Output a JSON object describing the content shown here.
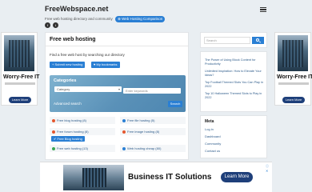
{
  "header": {
    "title": "FreeWebspace.net",
    "tagline": "Free web hosting directory and community",
    "comparison_pill": "⊕ Web Hosting Comparison"
  },
  "social": [
    "f",
    "t"
  ],
  "side_ad": {
    "headline": "Worry-Free IT",
    "cta": "Learn More"
  },
  "main": {
    "title": "Free web hosting",
    "intro": "Find a free web host by searching our directory",
    "submit_label": "+ Submit new hosting",
    "bookmarks_label": "♥ My bookmarks",
    "search": {
      "label": "Categories",
      "category_value": "Category",
      "keywords_placeholder": "Enter keywords",
      "advanced": "Advanced search",
      "button": "Search"
    },
    "categories": [
      {
        "label": "Free blog hosting (8)",
        "color": "#e4572e"
      },
      {
        "label": "Free file hosting (5)",
        "color": "#2a7fd4"
      },
      {
        "label": "Free forum hosting (8)",
        "color": "#e4572e"
      },
      {
        "label": "Free image hosting (8)",
        "color": "#e4572e"
      },
      {
        "label": "Free web hosting (13)",
        "color": "#3aa655"
      },
      {
        "label": "Web hosting cheap (80)",
        "color": "#2a7fd4"
      }
    ],
    "tooltip": "✔ Free Blog hosting"
  },
  "sidebar": {
    "search_placeholder": "Search",
    "recent": [
      "The Power of Using Block Content for Productivity",
      "Unlimited Inspiration: How to Elevate Your Ideas?",
      "Top Football Themed Slots You Can Play in 2022",
      "Top 10 Halloween Themed Slots to Play in 2022"
    ],
    "meta": {
      "title": "Meta",
      "links": [
        "Log in",
        "Dashboard",
        "Community",
        "Contact us"
      ]
    }
  },
  "bottom_ad": {
    "headline": "Business IT Solutions",
    "cta": "Learn More",
    "close": "ⓘ ✕"
  }
}
